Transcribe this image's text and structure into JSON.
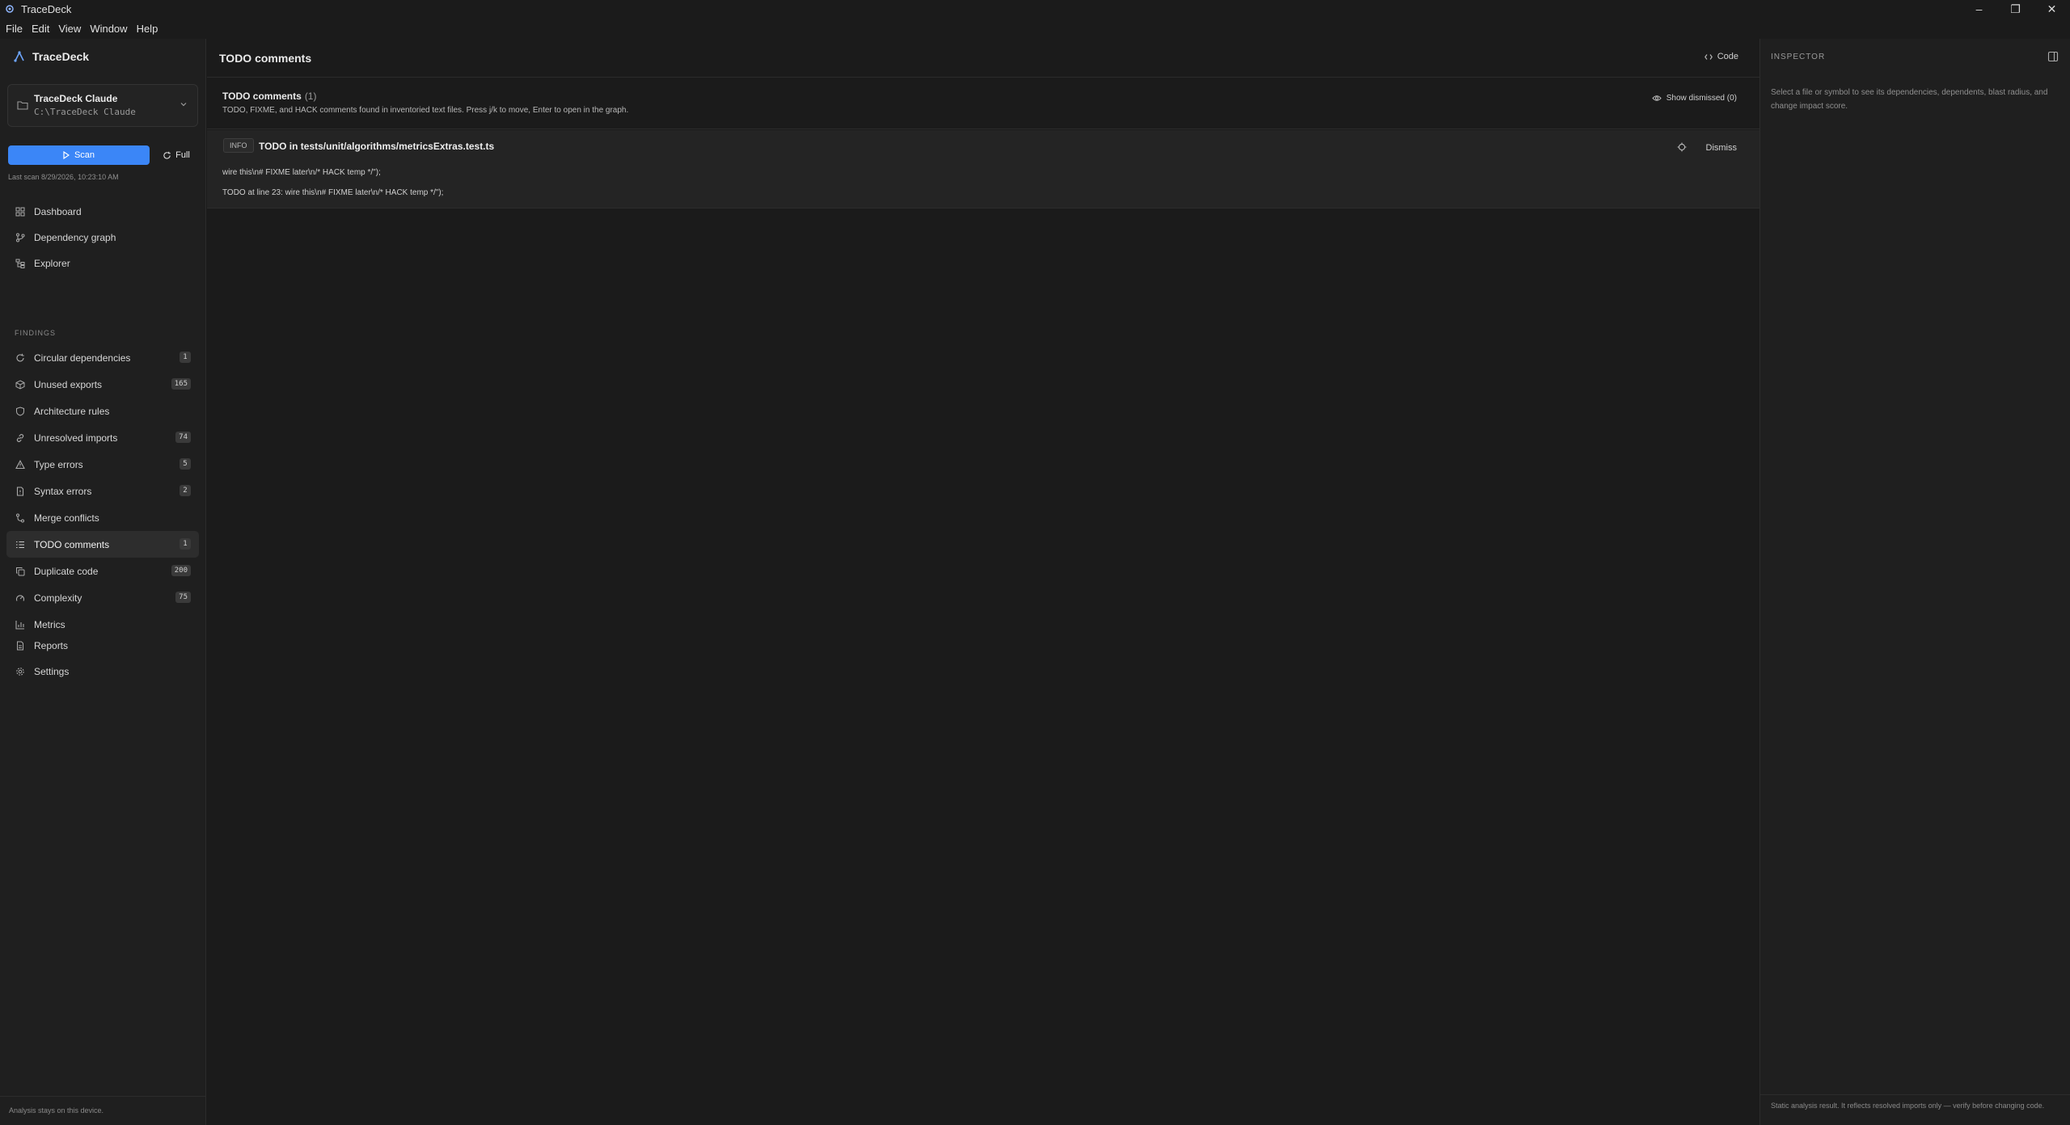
{
  "window": {
    "app_name": "TraceDeck",
    "controls": {
      "minimize": "–",
      "maximize": "❐",
      "close": "✕"
    }
  },
  "menu": [
    "File",
    "Edit",
    "View",
    "Window",
    "Help"
  ],
  "sidebar": {
    "brand": "TraceDeck",
    "workspace": {
      "name": "TraceDeck Claude",
      "path": "C:\\TraceDeck Claude"
    },
    "scan_label": "Scan",
    "full_label": "Full",
    "last_scan": "Last scan 8/29/2026, 10:23:10 AM",
    "nav_top": [
      {
        "label": "Dashboard",
        "icon": "dashboard-icon"
      },
      {
        "label": "Dependency graph",
        "icon": "graph-icon"
      },
      {
        "label": "Explorer",
        "icon": "explorer-icon"
      }
    ],
    "findings_label": "FINDINGS",
    "findings": [
      {
        "label": "Circular dependencies",
        "icon": "cycle-icon",
        "badge": "1"
      },
      {
        "label": "Unused exports",
        "icon": "package-icon",
        "badge": "165"
      },
      {
        "label": "Architecture rules",
        "icon": "shield-icon",
        "badge": ""
      },
      {
        "label": "Unresolved imports",
        "icon": "link-icon",
        "badge": "74"
      },
      {
        "label": "Type errors",
        "icon": "warning-icon",
        "badge": "5"
      },
      {
        "label": "Syntax errors",
        "icon": "file-error-icon",
        "badge": "2"
      },
      {
        "label": "Merge conflicts",
        "icon": "merge-icon",
        "badge": ""
      },
      {
        "label": "TODO comments",
        "icon": "todo-list-icon",
        "badge": "1",
        "active": true
      },
      {
        "label": "Duplicate code",
        "icon": "copy-icon",
        "badge": "200"
      },
      {
        "label": "Complexity",
        "icon": "gauge-icon",
        "badge": "75"
      },
      {
        "label": "Metrics",
        "icon": "bar-chart-icon",
        "badge": ""
      }
    ],
    "nav_bottom": [
      {
        "label": "Reports",
        "icon": "report-icon"
      },
      {
        "label": "Settings",
        "icon": "gear-icon"
      }
    ],
    "footer": "Analysis stays on this device."
  },
  "main": {
    "title": "TODO comments",
    "code_label": "Code",
    "list_title": "TODO comments",
    "list_count": "(1)",
    "list_desc": "TODO, FIXME, and HACK comments found in inventoried text files. Press j/k to move, Enter to open in the graph.",
    "show_dismissed": "Show dismissed (0)",
    "finding": {
      "severity": "INFO",
      "title": "TODO in tests/unit/algorithms/metricsExtras.test.ts",
      "snippet": "wire this\\n# FIXME later\\n/* HACK temp */\");",
      "detail": "TODO at line 23: wire this\\n# FIXME later\\n/* HACK temp */\");",
      "dismiss_label": "Dismiss"
    }
  },
  "inspector": {
    "title": "INSPECTOR",
    "empty": "Select a file or symbol to see its dependencies, dependents, blast radius, and change impact score.",
    "footer": "Static analysis result. It reflects resolved imports only — verify before changing code."
  },
  "colors": {
    "accent": "#3b86f7",
    "background": "#1b1b1b",
    "panel": "#1f1f1f",
    "active_nav": "#2d2d2d"
  }
}
